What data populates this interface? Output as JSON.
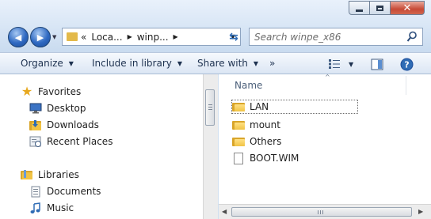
{
  "window": {
    "minimize_icon": "minimize-icon",
    "maximize_icon": "maximize-icon",
    "close_icon": "close-icon",
    "close_glyph": "✕"
  },
  "nav": {
    "back_glyph": "◀",
    "forward_glyph": "▶",
    "history_dropdown_glyph": "▼"
  },
  "address": {
    "overflow": "«",
    "segments": [
      {
        "label": "Loca...",
        "arrow": "▶"
      },
      {
        "label": "winp...",
        "arrow": "▶"
      }
    ],
    "dropdown_glyph": "▼",
    "refresh_glyph": "⇆"
  },
  "search": {
    "placeholder": "Search winpe_x86"
  },
  "toolbar": {
    "organize": "Organize",
    "include_in_library": "Include in library",
    "share_with": "Share with",
    "more": "»",
    "dropdown_glyph": "▼"
  },
  "nav_pane": {
    "favorites": {
      "label": "Favorites",
      "items": [
        "Desktop",
        "Downloads",
        "Recent Places"
      ]
    },
    "libraries": {
      "label": "Libraries",
      "items": [
        "Documents",
        "Music"
      ]
    }
  },
  "file_list": {
    "column_name": "Name",
    "sort_glyph": "^",
    "items": [
      {
        "name": "LAN",
        "type": "folder"
      },
      {
        "name": "mount",
        "type": "folder"
      },
      {
        "name": "Others",
        "type": "folder"
      },
      {
        "name": "BOOT.WIM",
        "type": "file"
      }
    ]
  },
  "colors": {
    "folder": "#f1c345",
    "accent": "#2f6cb5",
    "close": "#c74a36"
  }
}
